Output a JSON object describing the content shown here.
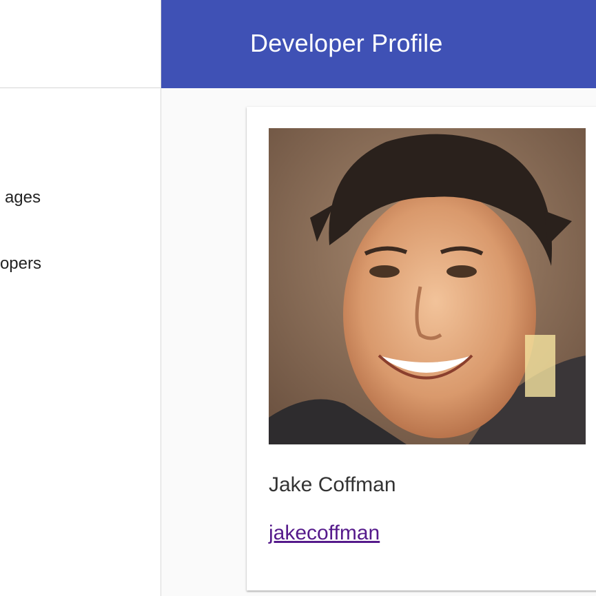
{
  "sidebar": {
    "items": [
      {
        "label": "ages"
      },
      {
        "label": "opers"
      }
    ]
  },
  "header": {
    "title": "Developer Profile",
    "color": "#3f51b5"
  },
  "profile": {
    "name": "Jake Coffman",
    "username": "jakecoffman",
    "link_color": "#551a8b",
    "photo": "profile-photo"
  }
}
